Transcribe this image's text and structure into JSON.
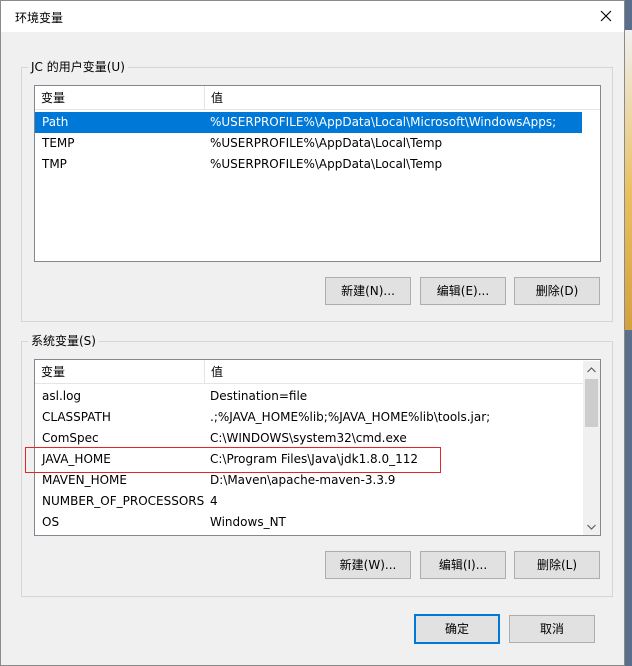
{
  "window": {
    "title": "环境变量"
  },
  "user_section": {
    "label": "JC 的用户变量(U)",
    "columns": [
      "变量",
      "值"
    ],
    "rows": [
      {
        "name": "Path",
        "value": "%USERPROFILE%\\AppData\\Local\\Microsoft\\WindowsApps;",
        "selected": true
      },
      {
        "name": "TEMP",
        "value": "%USERPROFILE%\\AppData\\Local\\Temp",
        "selected": false
      },
      {
        "name": "TMP",
        "value": "%USERPROFILE%\\AppData\\Local\\Temp",
        "selected": false
      }
    ],
    "buttons": {
      "new": "新建(N)...",
      "edit": "编辑(E)...",
      "delete": "删除(D)"
    }
  },
  "system_section": {
    "label": "系统变量(S)",
    "columns": [
      "变量",
      "值"
    ],
    "rows": [
      {
        "name": "asl.log",
        "value": "Destination=file"
      },
      {
        "name": "CLASSPATH",
        "value": ".;%JAVA_HOME%lib;%JAVA_HOME%lib\\tools.jar;"
      },
      {
        "name": "ComSpec",
        "value": "C:\\WINDOWS\\system32\\cmd.exe"
      },
      {
        "name": "JAVA_HOME",
        "value": "C:\\Program Files\\Java\\jdk1.8.0_112"
      },
      {
        "name": "MAVEN_HOME",
        "value": "D:\\Maven\\apache-maven-3.3.9"
      },
      {
        "name": "NUMBER_OF_PROCESSORS",
        "value": "4"
      },
      {
        "name": "OS",
        "value": "Windows_NT"
      }
    ],
    "buttons": {
      "new": "新建(W)...",
      "edit": "编辑(I)...",
      "delete": "删除(L)"
    }
  },
  "footer": {
    "ok": "确定",
    "cancel": "取消"
  },
  "colors": {
    "selection": "#0078d7",
    "highlight": "#e0272b"
  }
}
